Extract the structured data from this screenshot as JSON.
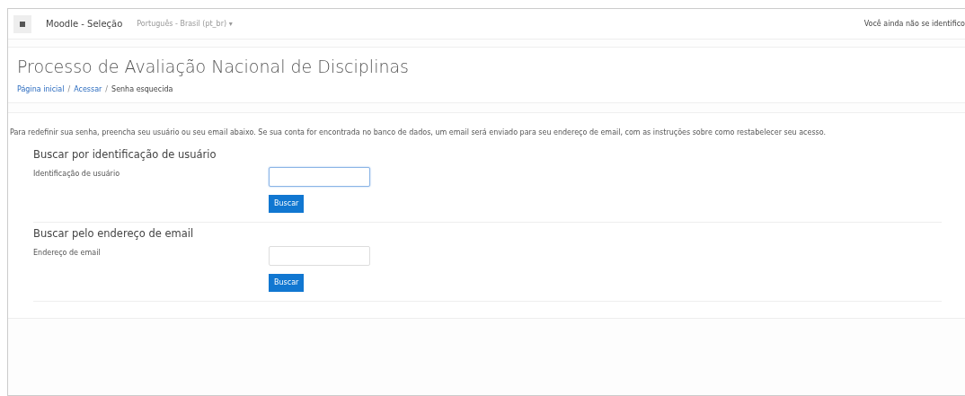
{
  "navbar": {
    "brand": "Moodle - Seleção",
    "language": "Português - Brasil (pt_br) ▾",
    "login_status": "Você ainda não se identifico"
  },
  "header": {
    "title": "Processo de Avaliação Nacional de Disciplinas",
    "breadcrumb_separator": "/",
    "breadcrumb": [
      {
        "label": "Página inicial",
        "link": true
      },
      {
        "label": "Acessar",
        "link": true
      },
      {
        "label": "Senha esquecida",
        "link": false
      }
    ]
  },
  "intro": "Para redefinir sua senha, preencha seu usuário ou seu email abaixo. Se sua conta for encontrada no banco de dados, um email será enviado para seu endereço de email, com as instruções sobre como restabelecer seu acesso.",
  "sections": [
    {
      "heading": "Buscar por identificação de usuário",
      "field_label": "Identificação de usuário",
      "focused": true,
      "button": "Buscar"
    },
    {
      "heading": "Buscar pelo endereço de email",
      "field_label": "Endereço de email",
      "focused": false,
      "button": "Buscar"
    }
  ]
}
